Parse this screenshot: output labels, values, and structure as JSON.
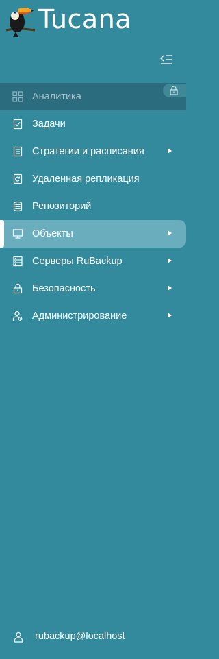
{
  "app": {
    "title": "Tucana"
  },
  "sidebar": {
    "collapse_icon": "collapse-menu-icon",
    "items": [
      {
        "label": "Аналитика",
        "icon": "grid-icon",
        "state": "disabled",
        "locked": true
      },
      {
        "label": "Задачи",
        "icon": "clipboard-check-icon"
      },
      {
        "label": "Стратегии и расписания",
        "icon": "document-list-icon",
        "has_submenu": true
      },
      {
        "label": "Удаленная репликация",
        "icon": "sync-document-icon"
      },
      {
        "label": "Репозиторий",
        "icon": "database-icon"
      },
      {
        "label": "Объекты",
        "icon": "monitor-icon",
        "state": "active",
        "has_submenu": true
      },
      {
        "label": "Серверы RuBackup",
        "icon": "server-icon",
        "has_submenu": true
      },
      {
        "label": "Безопасность",
        "icon": "lock-icon",
        "has_submenu": true
      },
      {
        "label": "Администрирование",
        "icon": "admin-user-icon",
        "has_submenu": true
      }
    ]
  },
  "user": {
    "name": "rubackup@localhost",
    "icon": "user-icon"
  },
  "colors": {
    "background": "#328a9c",
    "active": "#6aadbd",
    "disabled": "#2b6d7e",
    "text": "#ffffff"
  }
}
